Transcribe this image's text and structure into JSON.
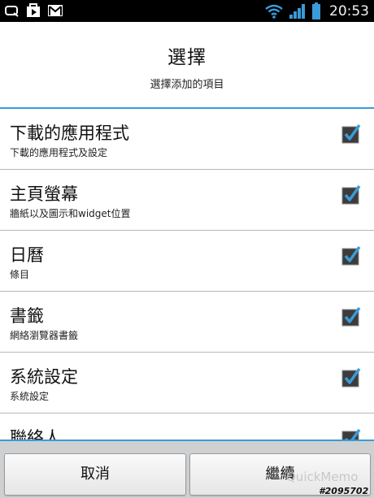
{
  "status_bar": {
    "time": "20:53",
    "left_icons": [
      "notification-q-icon",
      "play-store-icon",
      "gmail-icon"
    ],
    "right_icons": [
      "wifi-icon",
      "signal-icon",
      "battery-icon"
    ]
  },
  "dialog": {
    "title": "選擇",
    "subtitle": "選擇添加的項目",
    "items": [
      {
        "title": "下載的應用程式",
        "subtitle": "下載的應用程式及設定",
        "checked": true
      },
      {
        "title": "主頁螢幕",
        "subtitle": "牆紙以及圖示和widget位置",
        "checked": true
      },
      {
        "title": "日曆",
        "subtitle": "條目",
        "checked": true
      },
      {
        "title": "書籤",
        "subtitle": "網絡瀏覽器書籤",
        "checked": true
      },
      {
        "title": "系統設定",
        "subtitle": "系統設定",
        "checked": true
      },
      {
        "title": "聯絡人",
        "subtitle": "",
        "checked": true
      }
    ],
    "buttons": {
      "cancel": "取消",
      "continue": "繼續"
    }
  },
  "watermark": {
    "app": "QuickMemo",
    "id": "#2095702"
  },
  "colors": {
    "accent": "#3a9bd8",
    "check": "#3a9bd8",
    "status_bar": "#000000"
  }
}
